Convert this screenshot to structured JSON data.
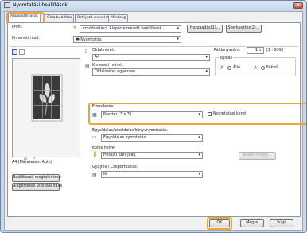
{
  "window": {
    "title": "Nyomtatási beállítások",
    "close_glyph": "✕"
  },
  "tabs": [
    {
      "label": "Alapbeállítások"
    },
    {
      "label": "Oldalbeállítás"
    },
    {
      "label": "Befejező művelet"
    },
    {
      "label": "Minőség"
    }
  ],
  "profile": {
    "label": "Profil:",
    "value": "<módosítás> Alapértelmezett beállítások",
    "add_button": "Hozzáadás(1)...",
    "edit_button": "Szerkesztés(2)..."
  },
  "output_method": {
    "label": "Kimeneti mód:",
    "value": "Nyomtatás"
  },
  "preview": {
    "caption": "A4 [Méretezés: Auto]",
    "a_glyph": "A"
  },
  "left_buttons": {
    "settings_display": "Beállítások megtekintése",
    "restore_defaults": "Alapértékek visszaállítása"
  },
  "page_size": {
    "label": "Oldalméret:",
    "value": "A4"
  },
  "output_size": {
    "label": "Kimeneti méret:",
    "value": "Oldalméret egyezzen"
  },
  "copies": {
    "label": "Példányszám:",
    "value": "1",
    "range": "[1 - 999]"
  },
  "orientation": {
    "label": "Tájolás",
    "portrait": "Álló",
    "landscape": "Fekvő",
    "selected": "portrait"
  },
  "layout": {
    "label": "Elrendezés:",
    "value": "Poszter [3 x 3]",
    "page_border_label": "Nyomtatási keret"
  },
  "duplex": {
    "label": "Egyoldalas/kétoldalas/könyvnyomtatás:",
    "value": "Egyoldalas nyomtatás"
  },
  "binding": {
    "label": "Kötés helye:",
    "value": "Hosszú szél [bal]",
    "margin_button": "Kötési margó..."
  },
  "collate": {
    "label": "Gyűjtés / Csoportosítás:",
    "value": "Ki"
  },
  "footer": {
    "ok": "OK",
    "cancel": "Mégse",
    "help": "Súgó"
  },
  "colors": {
    "highlight": "#f0a53a",
    "accent": "#1f5fbf"
  }
}
